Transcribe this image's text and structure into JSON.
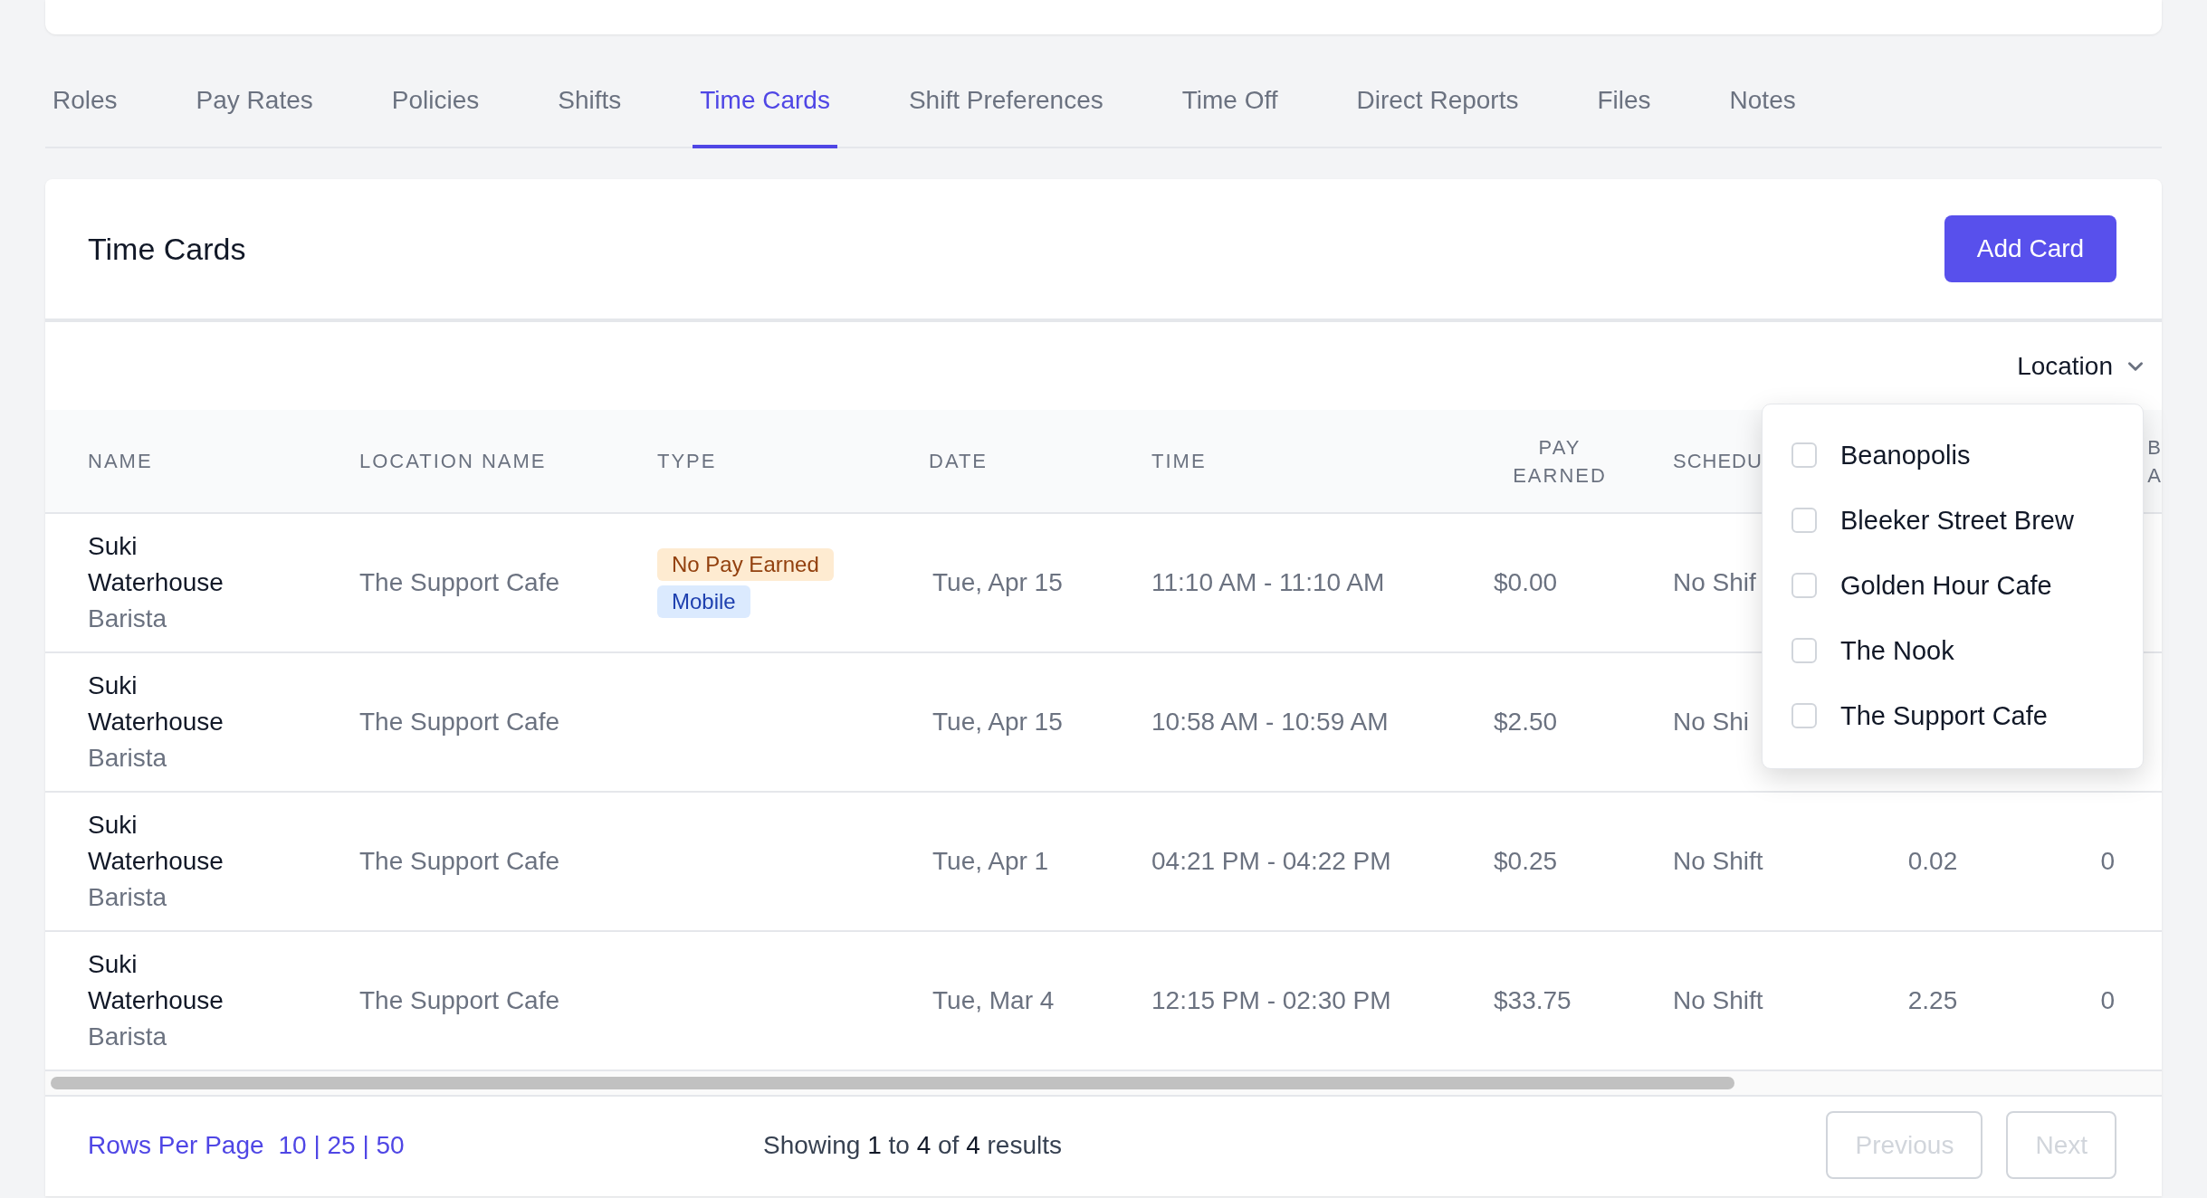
{
  "tabs": [
    {
      "label": "Roles",
      "selected": false
    },
    {
      "label": "Pay Rates",
      "selected": false
    },
    {
      "label": "Policies",
      "selected": false
    },
    {
      "label": "Shifts",
      "selected": false
    },
    {
      "label": "Time Cards",
      "selected": true
    },
    {
      "label": "Shift Preferences",
      "selected": false
    },
    {
      "label": "Time Off",
      "selected": false
    },
    {
      "label": "Direct Reports",
      "selected": false
    },
    {
      "label": "Files",
      "selected": false
    },
    {
      "label": "Notes",
      "selected": false
    }
  ],
  "card": {
    "title": "Time Cards",
    "add_button": "Add Card"
  },
  "filter": {
    "label": "Location",
    "expanded": true,
    "options": [
      {
        "label": "Beanopolis",
        "checked": false
      },
      {
        "label": "Bleeker Street Brew",
        "checked": false
      },
      {
        "label": "Golden Hour Cafe",
        "checked": false
      },
      {
        "label": "The Nook",
        "checked": false
      },
      {
        "label": "The Support Cafe",
        "checked": false
      }
    ]
  },
  "table": {
    "columns": [
      {
        "lines": [
          "NAME"
        ]
      },
      {
        "lines": [
          "LOCATION NAME"
        ]
      },
      {
        "lines": [
          "TYPE"
        ]
      },
      {
        "lines": [
          "DATE"
        ]
      },
      {
        "lines": [
          "TIME"
        ]
      },
      {
        "lines": [
          "PAY",
          "EARNED"
        ]
      },
      {
        "lines": [
          "SCHEDU"
        ]
      },
      {},
      {
        "lines": [
          "B",
          "A"
        ]
      }
    ],
    "rows": [
      {
        "name": "Suki Waterhouse",
        "role": "Barista",
        "location": "The Support Cafe",
        "badges": [
          {
            "label": "No Pay Earned",
            "kind": "warning"
          },
          {
            "label": "Mobile",
            "kind": "info"
          }
        ],
        "date": "Tue, Apr 15",
        "time": "11:10 AM - 11:10 AM",
        "pay": "$0.00",
        "schedule": "No Shif"
      },
      {
        "name": "Suki Waterhouse",
        "role": "Barista",
        "location": "The Support Cafe",
        "badges": [],
        "date": "Tue, Apr 15",
        "time": "10:58 AM - 10:59 AM",
        "pay": "$2.50",
        "schedule": "No Shi"
      },
      {
        "name": "Suki Waterhouse",
        "role": "Barista",
        "location": "The Support Cafe",
        "badges": [],
        "date": "Tue, Apr 1",
        "time": "04:21 PM - 04:22 PM",
        "pay": "$0.25",
        "schedule": "No Shift",
        "hours": "0.02",
        "column_9": "0"
      },
      {
        "name": "Suki Waterhouse",
        "role": "Barista",
        "location": "The Support Cafe",
        "badges": [],
        "date": "Tue, Mar 4",
        "time": "12:15 PM - 02:30 PM",
        "pay": "$33.75",
        "schedule": "No Shift",
        "hours": "2.25",
        "column_9": "0"
      }
    ]
  },
  "footer": {
    "rows_per_page": "Rows Per Page",
    "page_sizes": "10 | 25 | 50",
    "summary": "Showing **1** to **4** of **4** results",
    "buttons": [
      {
        "label": "Previous",
        "disabled": true
      },
      {
        "label": "Next",
        "disabled": true
      }
    ]
  }
}
